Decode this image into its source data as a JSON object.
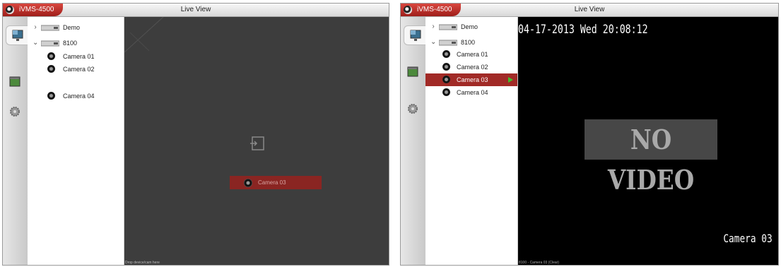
{
  "left": {
    "app_name": "iVMS-4500",
    "window_title": "Live View",
    "toolbar": [
      {
        "icon": "live-view-icon",
        "active": true
      },
      {
        "icon": "playback-icon",
        "active": false
      },
      {
        "icon": "settings-gear-icon",
        "active": false
      }
    ],
    "tree": {
      "devices": [
        {
          "label": "Demo",
          "expanded": false
        },
        {
          "label": "8100",
          "expanded": true
        }
      ],
      "cameras": [
        "Camera 01",
        "Camera 02",
        "Camera 04"
      ]
    },
    "drag_label": "Camera 03",
    "hint": "Drop device/cam here"
  },
  "right": {
    "app_name": "iVMS-4500",
    "window_title": "Live View",
    "tree": {
      "devices": [
        {
          "label": "Demo",
          "expanded": false
        },
        {
          "label": "8100",
          "expanded": true
        }
      ],
      "cameras": [
        {
          "label": "Camera 01",
          "selected": false
        },
        {
          "label": "Camera 02",
          "selected": false
        },
        {
          "label": "Camera 03",
          "selected": true,
          "playing": true
        },
        {
          "label": "Camera 04",
          "selected": false
        }
      ]
    },
    "video": {
      "timestamp": "04-17-2013 Wed 20:08:12",
      "no_video": "NO VIDEO",
      "camera_name": "Camera 03",
      "status": "8100 - Camera 03 (Clear)"
    }
  },
  "colors": {
    "accent_red": "#a12a26",
    "play_green": "#3fbf2a",
    "video_bg": "#000000",
    "empty_view": "#3d3d3d"
  }
}
